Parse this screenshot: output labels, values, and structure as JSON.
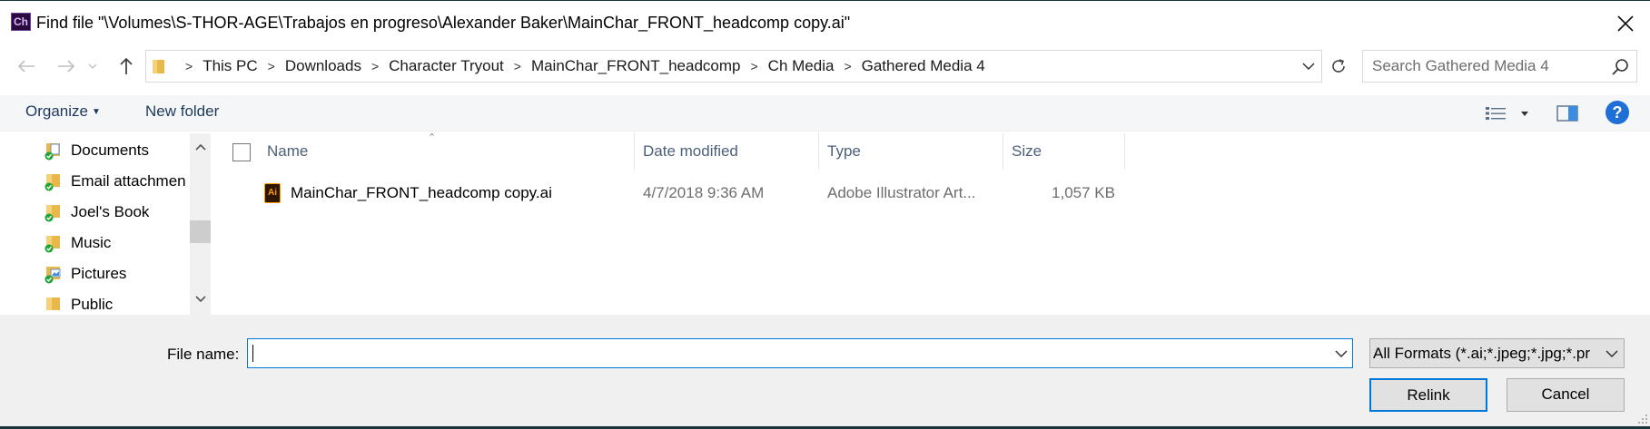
{
  "window": {
    "title": "Find file \"\\Volumes\\S-THOR-AGE\\Trabajos en progreso\\Alexander Baker\\MainChar_FRONT_headcomp copy.ai\"",
    "app_icon_text": "Ch"
  },
  "address": {
    "crumbs": [
      "This PC",
      "Downloads",
      "Character Tryout",
      "MainChar_FRONT_headcomp",
      "Ch Media",
      "Gathered Media 4"
    ]
  },
  "search": {
    "placeholder": "Search Gathered Media 4"
  },
  "toolbar": {
    "organize_label": "Organize",
    "new_folder_label": "New folder",
    "help_label": "?"
  },
  "nav": {
    "items": [
      {
        "label": "Documents",
        "icon": "documents-folder-icon"
      },
      {
        "label": "Email attachmen",
        "icon": "folder-icon"
      },
      {
        "label": "Joel's Book",
        "icon": "folder-icon"
      },
      {
        "label": "Music",
        "icon": "folder-icon"
      },
      {
        "label": "Pictures",
        "icon": "pictures-folder-icon"
      },
      {
        "label": "Public",
        "icon": "folder-icon"
      }
    ]
  },
  "columns": {
    "name": "Name",
    "date": "Date modified",
    "type": "Type",
    "size": "Size"
  },
  "files": [
    {
      "name": "MainChar_FRONT_headcomp copy.ai",
      "icon_text": "Ai",
      "date": "4/7/2018 9:36 AM",
      "type": "Adobe Illustrator Art...",
      "size": "1,057 KB"
    }
  ],
  "bottom": {
    "file_name_label": "File name:",
    "file_name_value": "",
    "format_selected": "All Formats (*.ai;*.jpeg;*.jpg;*.pr",
    "relink_label": "Relink",
    "cancel_label": "Cancel"
  },
  "colors": {
    "accent": "#0078d7",
    "folder": "#e8b94a",
    "sync_check": "#21a336",
    "illustrator_orange": "#ff9a00"
  }
}
